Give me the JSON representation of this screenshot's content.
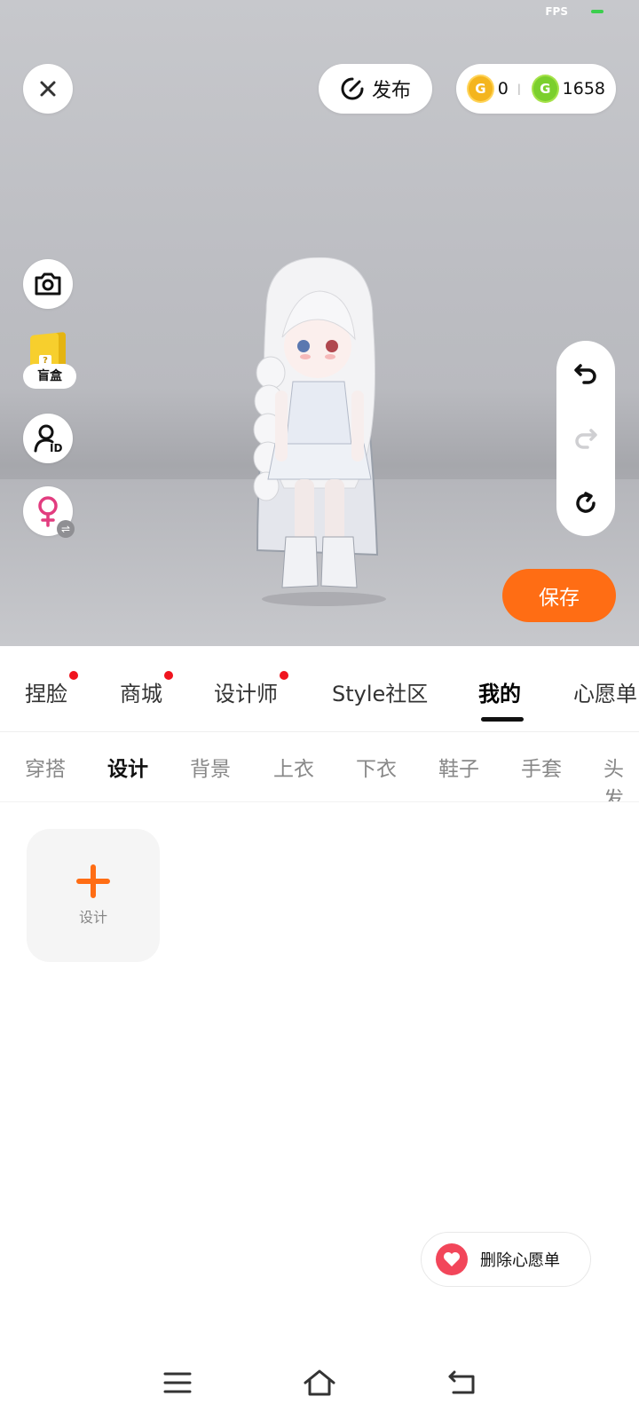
{
  "status": {
    "fps_label": "FPS"
  },
  "top": {
    "close_icon": "close-icon",
    "publish_label": "发布",
    "coins": {
      "gold": "0",
      "green": "1658"
    }
  },
  "side": {
    "camera_icon": "camera-icon",
    "blind_box_label": "盲盒",
    "id_icon": "user-id-icon",
    "gender_icon": "female-icon"
  },
  "history": {
    "undo": "undo-icon",
    "redo": "redo-icon",
    "reset": "reset-icon"
  },
  "save_label": "保存",
  "main_tabs": [
    {
      "label": "捏脸",
      "dot": true
    },
    {
      "label": "商城",
      "dot": true
    },
    {
      "label": "设计师",
      "dot": true
    },
    {
      "label": "Style社区",
      "dot": false
    },
    {
      "label": "我的",
      "dot": false,
      "active": true
    },
    {
      "label": "心愿单",
      "dot": false
    }
  ],
  "sub_tabs": [
    {
      "label": "穿搭"
    },
    {
      "label": "设计",
      "active": true
    },
    {
      "label": "背景"
    },
    {
      "label": "上衣"
    },
    {
      "label": "下衣"
    },
    {
      "label": "鞋子"
    },
    {
      "label": "手套"
    },
    {
      "label": "头发"
    }
  ],
  "design_card": {
    "label": "设计"
  },
  "wishlist_button": {
    "label": "删除心愿单"
  },
  "colors": {
    "accent": "#ff6d14",
    "heart": "#f2465a",
    "dot": "#f0141e"
  }
}
